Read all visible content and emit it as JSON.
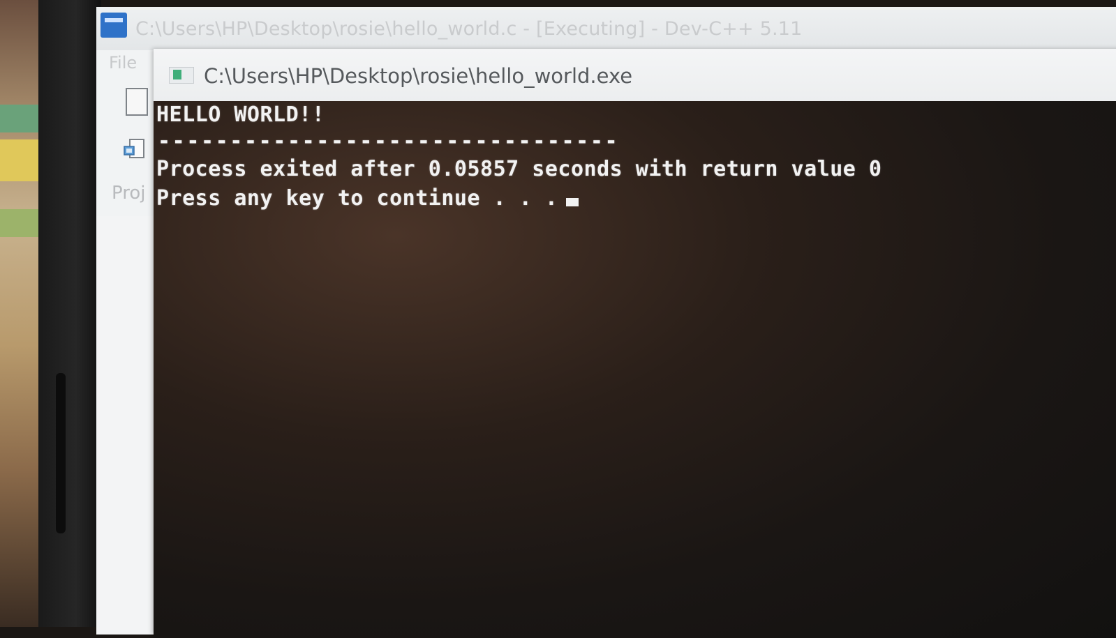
{
  "devcpp": {
    "window_title": "C:\\Users\\HP\\Desktop\\rosie\\hello_world.c - [Executing] - Dev-C++ 5.11",
    "menu_file": "File",
    "panel_label": "Proj"
  },
  "console": {
    "title": "C:\\Users\\HP\\Desktop\\rosie\\hello_world.exe",
    "lines": [
      "HELLO WORLD!!",
      "--------------------------------",
      "Process exited after 0.05857 seconds with return value 0",
      "Press any key to continue . . ."
    ]
  },
  "colors": {
    "console_background": "#1a1715",
    "console_text": "#f2f2f2",
    "app_icon": "#2f72c8"
  },
  "icons": [
    "dev-cpp-app-icon",
    "console-app-icon",
    "blank-page-icon",
    "copy-icon"
  ]
}
